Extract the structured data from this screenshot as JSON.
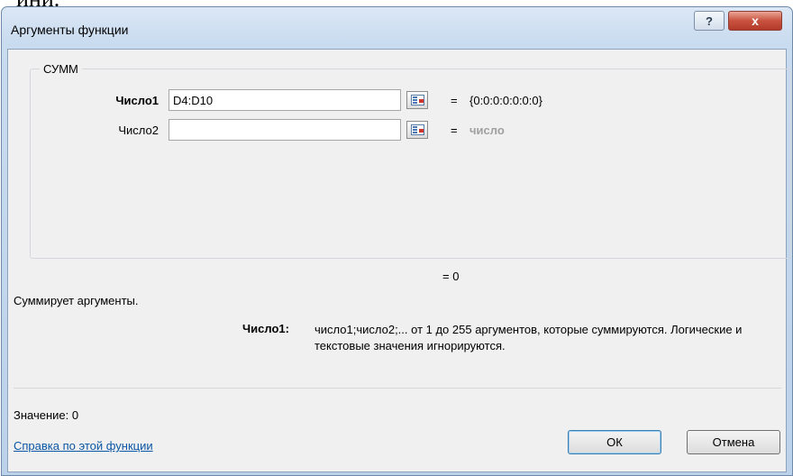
{
  "top_fragment": "ини.",
  "window": {
    "title": "Аргументы функции",
    "help_button": "?",
    "close_button": "x"
  },
  "function_group": {
    "name": "СУММ",
    "args": [
      {
        "label": "Число1",
        "value": "D4:D10",
        "result": "{0:0:0:0:0:0:0}"
      },
      {
        "label": "Число2",
        "value": "",
        "result": "число"
      }
    ],
    "equals": "="
  },
  "formula_result": "= 0",
  "description": "Суммирует аргументы.",
  "argument_help": {
    "name": "Число1:",
    "text": "число1;число2;... от 1 до 255 аргументов, которые суммируются. Логические и текстовые значения игнорируются."
  },
  "value_line": "Значение:  0",
  "help_link": "Справка по этой функции",
  "buttons": {
    "ok": "ОК",
    "cancel": "Отмена"
  }
}
